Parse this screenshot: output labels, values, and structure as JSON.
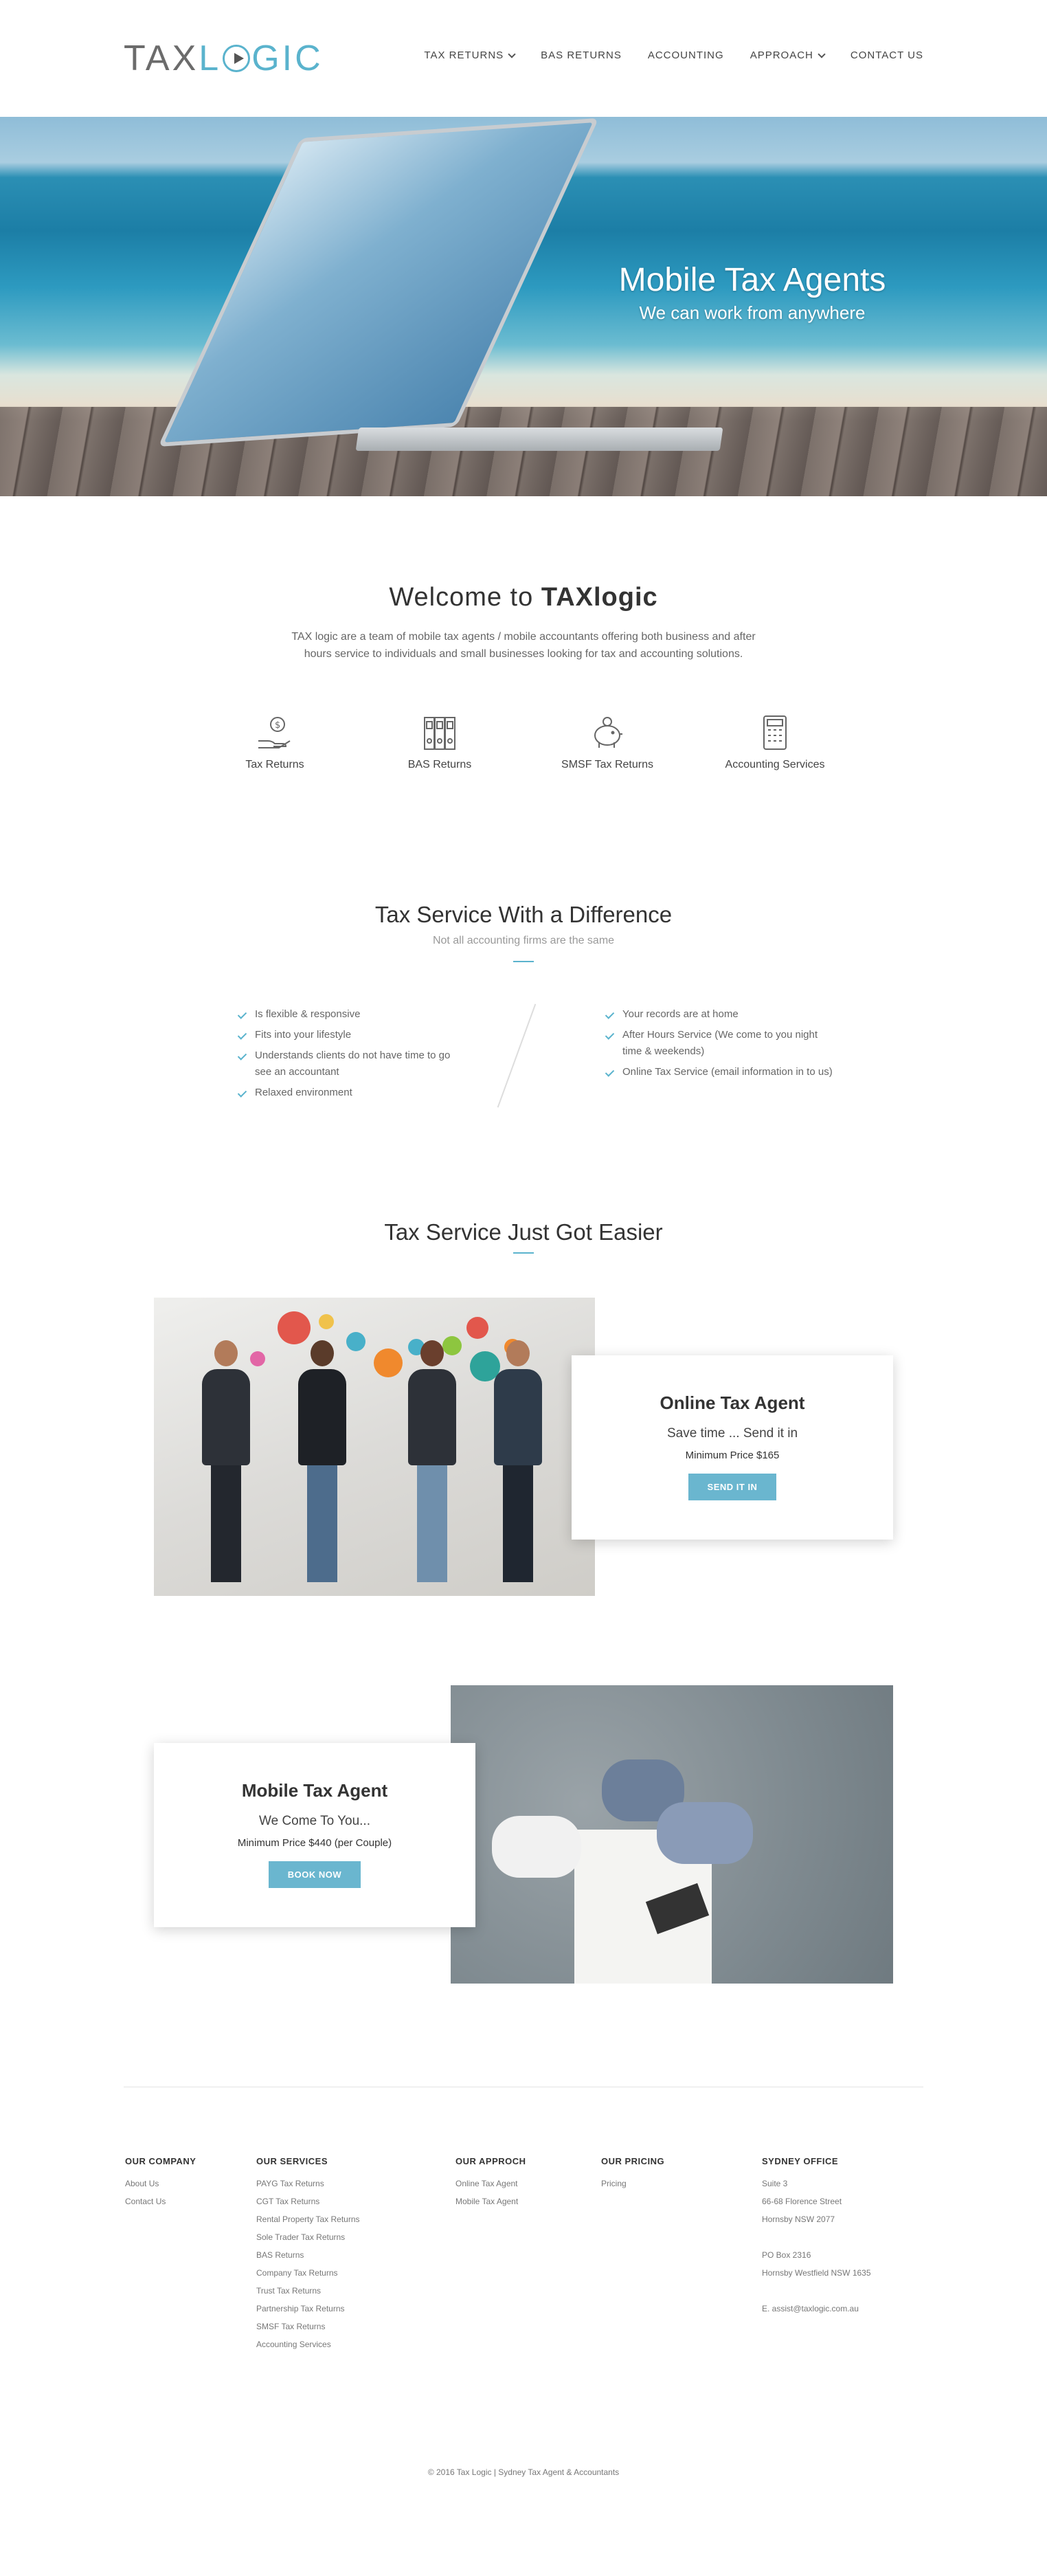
{
  "header": {
    "logo_left": "TAX",
    "logo_mid": "L",
    "logo_right": "GIC",
    "nav": [
      {
        "label": "TAX RETURNS"
      },
      {
        "label": "BAS RETURNS"
      },
      {
        "label": "ACCOUNTING"
      },
      {
        "label": "APPROACH"
      },
      {
        "label": "CONTACT US"
      }
    ]
  },
  "hero": {
    "title": "Mobile Tax Agents",
    "subtitle": "We can work from anywhere"
  },
  "welcome": {
    "title_prefix": "Welcome to",
    "title_brand": "TAXlogic",
    "text": "TAX logic are a team of mobile tax agents / mobile accountants offering both business and after hours service to individuals and small businesses looking for tax and accounting solutions.",
    "services": [
      {
        "label": "Tax Returns",
        "icon": "money-hand-icon"
      },
      {
        "label": "BAS Returns",
        "icon": "binders-icon"
      },
      {
        "label": "SMSF Tax Returns",
        "icon": "piggy-bank-icon"
      },
      {
        "label": "Accounting Services",
        "icon": "calculator-icon"
      }
    ]
  },
  "difference": {
    "title": "Tax Service With a Difference",
    "subtitle": "Not all accounting firms are the same",
    "left": [
      "Is flexible & responsive",
      "Fits into your lifestyle",
      "Understands clients do not have time to go see an accountant",
      "Relaxed environment"
    ],
    "right": [
      "Your records are at home",
      "After Hours Service (We come to you night time & weekends)",
      "Online Tax Service (email information in to us)"
    ]
  },
  "easier": {
    "title": "Tax Service Just Got Easier",
    "online": {
      "title": "Online Tax Agent",
      "subtitle": "Save time ... Send it in",
      "price": "Minimum Price $165",
      "button": "SEND IT IN"
    },
    "mobile": {
      "title": "Mobile Tax Agent",
      "subtitle": "We Come To You...",
      "price": "Minimum Price $440 (per Couple)",
      "button": "BOOK NOW"
    }
  },
  "footer": {
    "company": {
      "title": "OUR COMPANY",
      "items": [
        "About Us",
        "Contact Us"
      ]
    },
    "services": {
      "title": "OUR SERVICES",
      "items": [
        "PAYG Tax Returns",
        "CGT Tax Returns",
        "Rental Property Tax Returns",
        "Sole Trader Tax Returns",
        "BAS Returns",
        "Company Tax Returns",
        "Trust Tax Returns",
        "Partnership Tax Returns",
        "SMSF Tax Returns",
        "Accounting Services"
      ]
    },
    "approach": {
      "title": "OUR APPROCH",
      "items": [
        "Online Tax Agent",
        "Mobile Tax Agent"
      ]
    },
    "pricing": {
      "title": "OUR PRICING",
      "items": [
        "Pricing"
      ]
    },
    "office": {
      "title": "SYDNEY OFFICE",
      "line1": "Suite 3",
      "line2": "66-68 Florence Street",
      "line3": "Hornsby NSW 2077",
      "line4": "PO Box 2316",
      "line5": "Hornsby Westfield NSW 1635",
      "email": "E. assist@taxlogic.com.au"
    },
    "copyright": "© 2016 Tax Logic | Sydney Tax Agent & Accountants"
  }
}
